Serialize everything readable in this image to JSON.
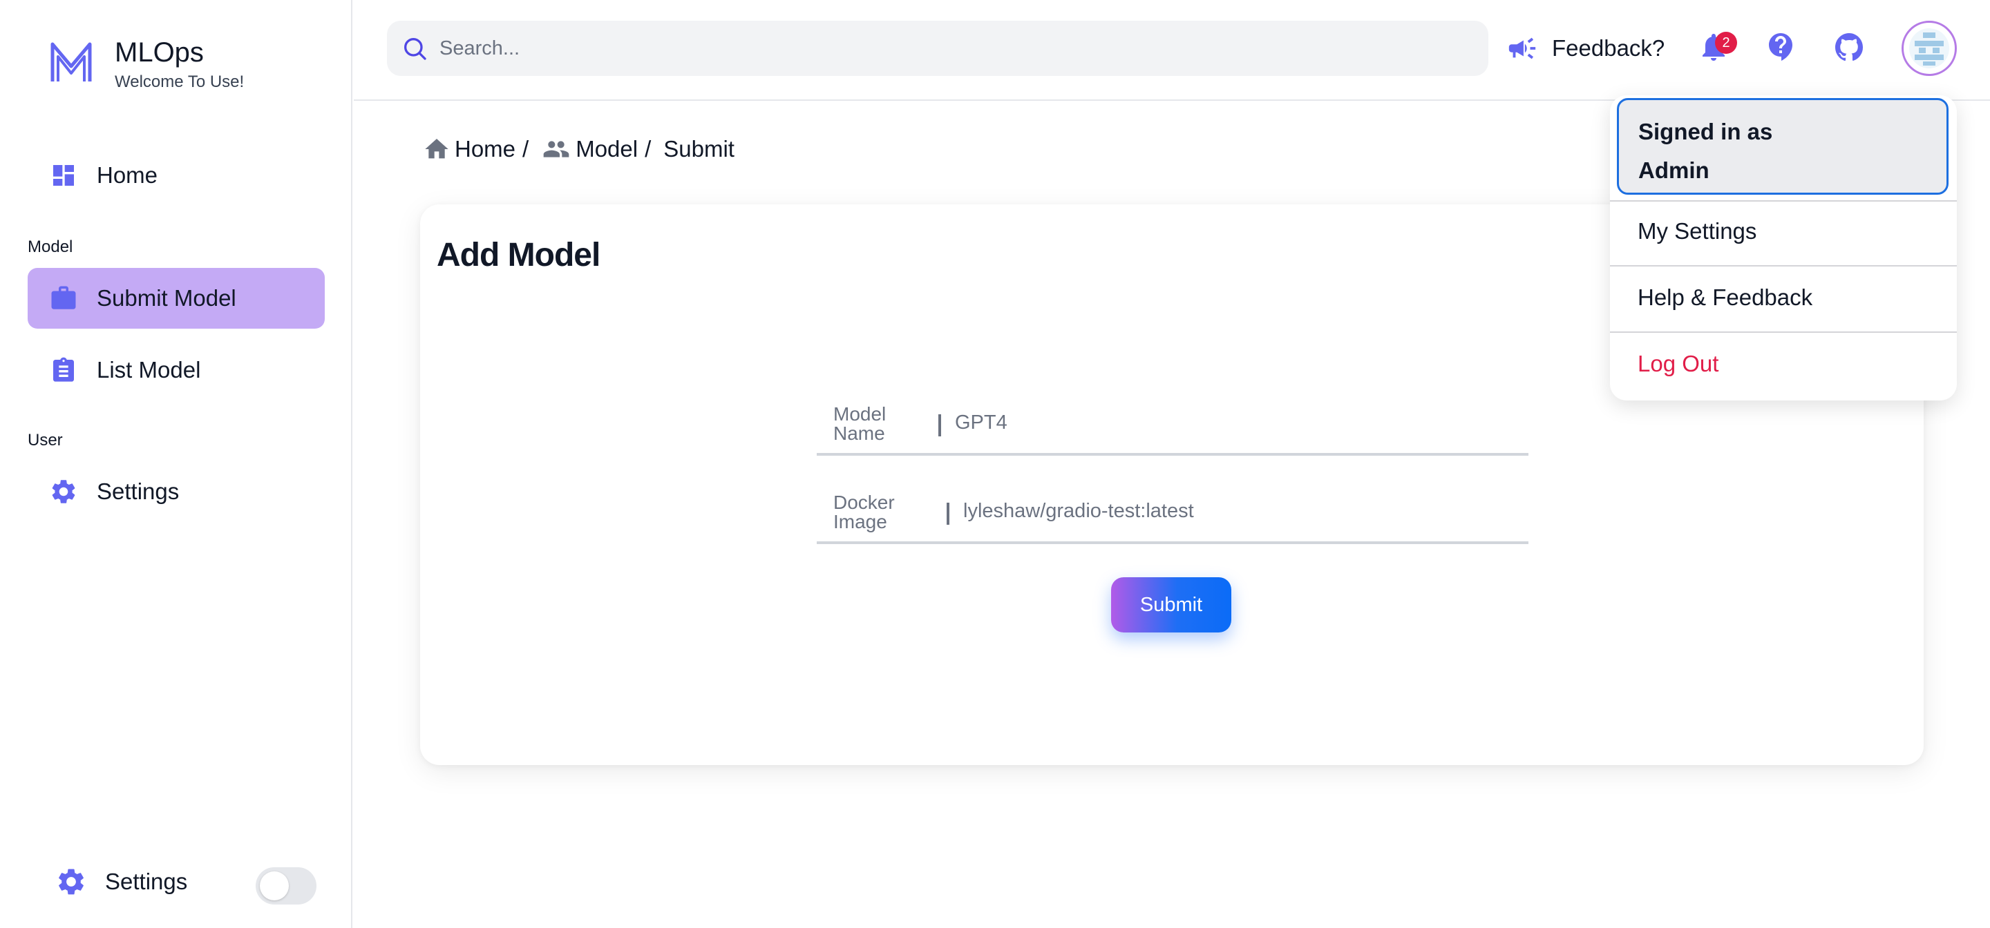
{
  "colors": {
    "accent": "#6366f1",
    "active_nav_bg": "#c4aaf5",
    "logout": "#e11d48",
    "badge": "#e11d48",
    "submit_gradient_start": "#b15be8",
    "submit_gradient_end": "#0b6cf7"
  },
  "brand": {
    "logo_icon": "m-logo-icon",
    "title": "MLOps",
    "subtitle": "Welcome To Use!"
  },
  "sidebar": {
    "home": {
      "label": "Home",
      "icon": "dashboard-icon"
    },
    "section_model": "Model",
    "submit_model": {
      "label": "Submit Model",
      "icon": "briefcase-icon",
      "active": true
    },
    "list_model": {
      "label": "List Model",
      "icon": "clipboard-icon"
    },
    "section_user": "User",
    "settings": {
      "label": "Settings",
      "icon": "gear-icon"
    },
    "bottom_settings": {
      "label": "Settings",
      "icon": "gear-icon",
      "toggle_on": false
    }
  },
  "topbar": {
    "search_placeholder": "Search...",
    "feedback_label": "Feedback?",
    "notification_count": "2"
  },
  "breadcrumb": {
    "home": "Home",
    "model": "Model",
    "current": "Submit",
    "separator": "/"
  },
  "form": {
    "title": "Add Model",
    "model_name_label_1": "Model",
    "model_name_label_2": "Name",
    "model_name_value": "GPT4",
    "docker_image_label_1": "Docker",
    "docker_image_label_2": "Image",
    "docker_image_value": "lyleshaw/gradio-test:latest",
    "submit_label": "Submit"
  },
  "user_menu": {
    "signed_in_line1": "Signed in as",
    "signed_in_line2": "Admin",
    "my_settings": "My Settings",
    "help_feedback": "Help & Feedback",
    "log_out": "Log Out"
  }
}
